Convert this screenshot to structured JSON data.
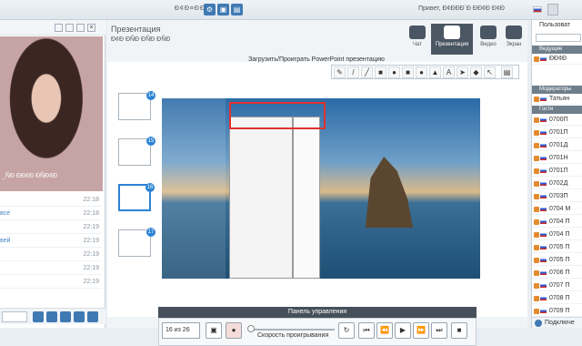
{
  "topbar": {
    "title": "Ð¢Ð¤ÐÐ´Ð",
    "greeting": "Привет, Ð¢ÐÐÐ´Ð ÐÐ¢Ð Ð¢Ð",
    "user_label": "Пользователи"
  },
  "left": {
    "caption": "_ÑÐ ÐÐ¢Ð ÐÑÐ¢Ð",
    "chat": [
      {
        "who": "",
        "time": "22:18"
      },
      {
        "who": "все",
        "time": "22:18"
      },
      {
        "who": "",
        "time": "22:19"
      },
      {
        "who": "вей",
        "time": "22:19"
      },
      {
        "who": "",
        "time": "22:19"
      },
      {
        "who": "",
        "time": "22:19"
      },
      {
        "who": "",
        "time": "22:19"
      }
    ]
  },
  "center": {
    "title": "Презентация",
    "subtitle": "Ð¢Ð ÐÑÐ ÐÑÐ ÐÑÐ",
    "modes": [
      {
        "label": "Чат"
      },
      {
        "label": "Презентация"
      },
      {
        "label": "Видео"
      },
      {
        "label": "Экран"
      }
    ],
    "upload_label": "Загрузить/Проиграть PowerPoint презентацию",
    "thumb_numbers": [
      "14",
      "15",
      "16",
      "17"
    ],
    "control_title": "Панель управления",
    "page_select": "16 из 26",
    "speed_label": "Скорость проигрывания"
  },
  "right": {
    "header": "Пользоват",
    "sections": [
      {
        "title": "Ведущие",
        "users": [
          "ÐÐ¢Ð"
        ]
      },
      {
        "title": "Модераторы",
        "users": [
          "Татьян"
        ]
      },
      {
        "title": "Гости",
        "users": [
          "0700П",
          "0701П",
          "0701Д",
          "0701Н",
          "0701П",
          "0702Д",
          "0703П",
          "0704 М",
          "0704 П",
          "0704 П",
          "0705 П",
          "0705 П",
          "0706 П",
          "0707 П",
          "0708 П",
          "0709 П",
          "0710 П"
        ]
      }
    ],
    "connect_label": "Подключе"
  }
}
